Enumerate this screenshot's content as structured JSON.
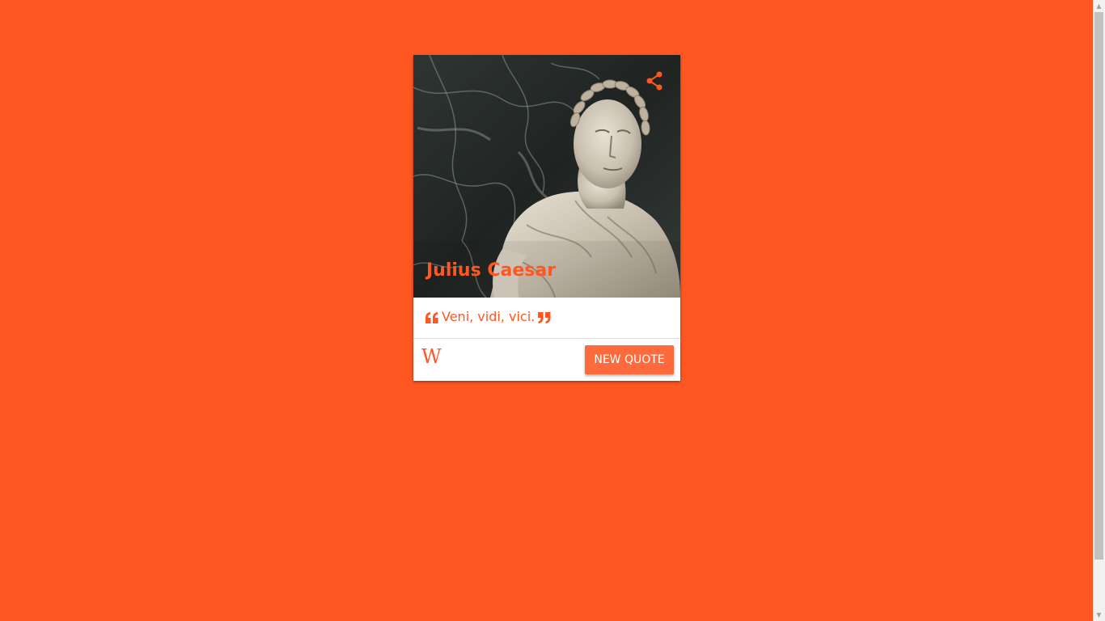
{
  "colors": {
    "background": "#ff5722",
    "accent": "#ff5722",
    "button": "#ff6a3d",
    "button_text": "#ffffff",
    "card": "#ffffff"
  },
  "card": {
    "image_subject": "marble bust of Julius Caesar wearing a laurel wreath",
    "author": "Julius Caesar",
    "quote": "Veni, vidi, vici.",
    "share_icon": "share-icon",
    "open_quote_icon": "quote-left-icon",
    "close_quote_icon": "quote-right-icon",
    "wiki_link": "W",
    "new_quote_label": "NEW QUOTE"
  }
}
